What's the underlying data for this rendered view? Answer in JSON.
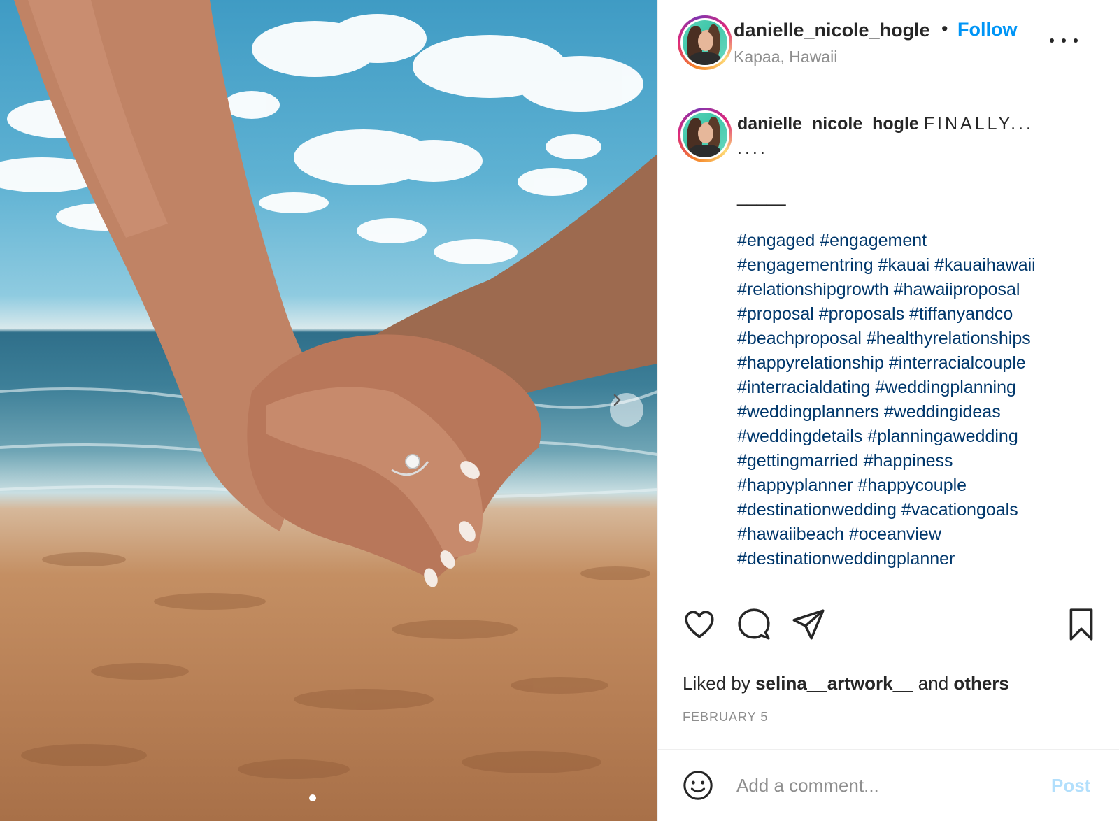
{
  "post": {
    "username": "danielle_nicole_hogle",
    "follow_label": "Follow",
    "separator": "•",
    "location": "Kapaa, Hawaii",
    "photo_description_icon": "photo-icon"
  },
  "caption": {
    "username": "danielle_nicole_hogle",
    "text_line1": "FINALLY...",
    "text_line2": "....",
    "rule": "_____",
    "hashtags": [
      "#engaged",
      "#engagement",
      "#engagementring",
      "#kauai",
      "#kauaihawaii",
      "#relationshipgrowth",
      "#hawaiiproposal",
      "#proposal",
      "#proposals",
      "#tiffanyandco",
      "#beachproposal",
      "#healthyrelationships",
      "#happyrelationship",
      "#interracialcouple",
      "#interracialdating",
      "#weddingplanning",
      "#weddingplanners",
      "#weddingideas",
      "#weddingdetails",
      "#planningawedding",
      "#gettingmarried",
      "#happiness",
      "#happyplanner",
      "#happycouple",
      "#destinationwedding",
      "#vacationgoals",
      "#hawaiibeach",
      "#oceanview",
      "#destinationweddingplanner"
    ]
  },
  "actions": {
    "icons": [
      "heart-icon",
      "comment-icon",
      "share-icon",
      "bookmark-icon"
    ]
  },
  "likes": {
    "prefix": "Liked by",
    "user": "selina__artwork__",
    "middle": "and",
    "others": "others"
  },
  "date": "FEBRUARY 5",
  "comment": {
    "placeholder": "Add a comment...",
    "post_label": "Post"
  },
  "colors": {
    "accent": "#0095f6",
    "hashtag": "#00376b",
    "post_disabled": "#b2dffc",
    "muted": "#8e8e8e"
  }
}
